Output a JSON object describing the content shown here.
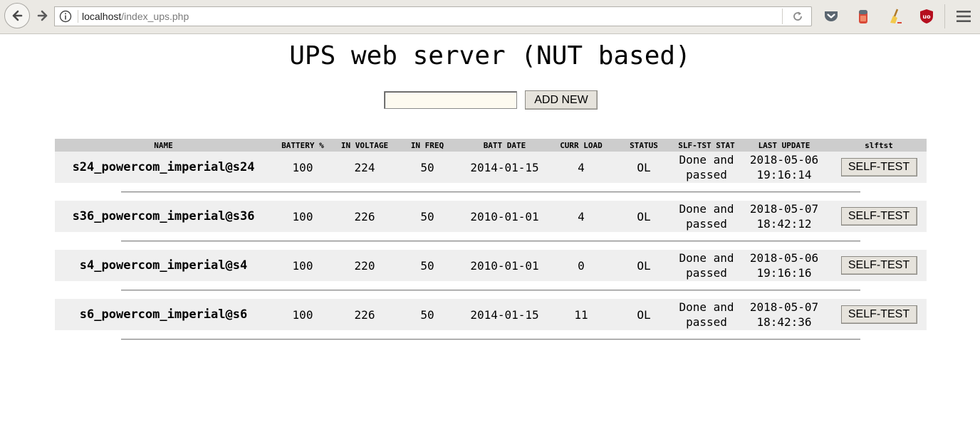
{
  "browser": {
    "url_host": "localhost",
    "url_path": "/index_ups.php"
  },
  "page": {
    "title": "UPS web server (NUT based)",
    "add_input_value": "",
    "add_button_label": "ADD NEW"
  },
  "table": {
    "headers": [
      "NAME",
      "BATTERY %",
      "IN VOLTAGE",
      "IN FREQ",
      "BATT DATE",
      "CURR LOAD",
      "STATUS",
      "SLF-TST STAT",
      "LAST UPDATE",
      "slftst"
    ],
    "rows": [
      {
        "name": "s24_powercom_imperial@s24",
        "battery": "100",
        "voltage": "224",
        "freq": "50",
        "batt_date": "2014-01-15",
        "load": "4",
        "status": "OL",
        "selftest_1": "Done and",
        "selftest_2": "passed",
        "date": "2018-05-06",
        "time": "19:16:14",
        "button": "SELF-TEST"
      },
      {
        "name": "s36_powercom_imperial@s36",
        "battery": "100",
        "voltage": "226",
        "freq": "50",
        "batt_date": "2010-01-01",
        "load": "4",
        "status": "OL",
        "selftest_1": "Done and",
        "selftest_2": "passed",
        "date": "2018-05-07",
        "time": "18:42:12",
        "button": "SELF-TEST"
      },
      {
        "name": "s4_powercom_imperial@s4",
        "battery": "100",
        "voltage": "220",
        "freq": "50",
        "batt_date": "2010-01-01",
        "load": "0",
        "status": "OL",
        "selftest_1": "Done and",
        "selftest_2": "passed",
        "date": "2018-05-06",
        "time": "19:16:16",
        "button": "SELF-TEST"
      },
      {
        "name": "s6_powercom_imperial@s6",
        "battery": "100",
        "voltage": "226",
        "freq": "50",
        "batt_date": "2014-01-15",
        "load": "11",
        "status": "OL",
        "selftest_1": "Done and",
        "selftest_2": "passed",
        "date": "2018-05-07",
        "time": "18:42:36",
        "button": "SELF-TEST"
      }
    ]
  },
  "toolbar": {
    "icons": [
      "pocket-icon",
      "extension-icon",
      "broom-icon",
      "ublock-icon",
      "menu-icon"
    ]
  },
  "colors": {
    "header_bg": "#cdcdcd",
    "row_bg": "#efefef",
    "ublock_red": "#b50e1e"
  }
}
